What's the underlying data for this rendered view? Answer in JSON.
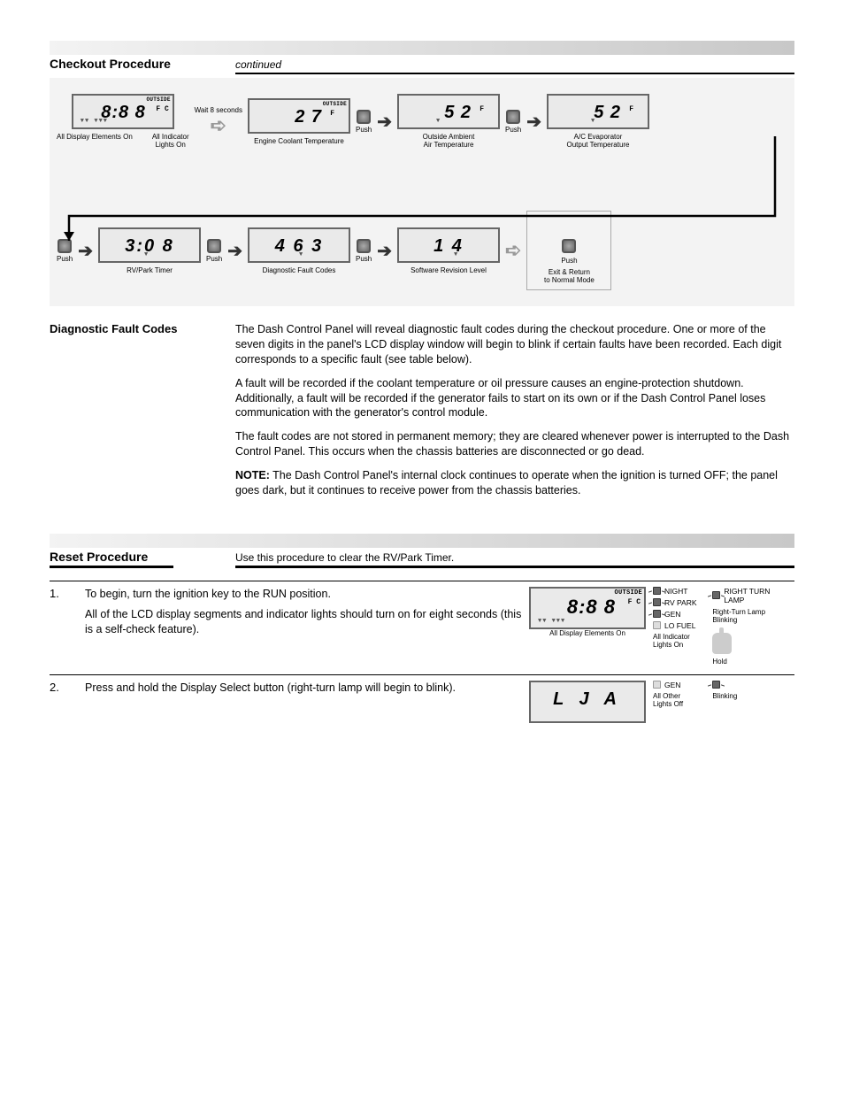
{
  "section1": {
    "title": "Checkout Procedure",
    "subtitle_suffix": "continued"
  },
  "flow": {
    "step1": {
      "outside": "OUTSIDE",
      "digits": "8:8 8",
      "fc": "F C",
      "arrows": "▼▼   ▼▼▼",
      "cap_left": "All Display Elements On",
      "cap_right": "All Indicator\nLights On"
    },
    "wait": "Wait 8 seconds",
    "step2": {
      "outside": "OUTSIDE",
      "digits": "2 7",
      "f": "F",
      "cap_left": "Engine Coolant Temperature",
      "cap_right": ""
    },
    "push": "Push",
    "step3": {
      "digits": "5 2",
      "f": "F",
      "arrow_pos": "▼",
      "cap_left": "Outside Ambient\nAir Temperature",
      "cap_right": ""
    },
    "step4": {
      "digits": "5 2",
      "f": "F",
      "arrow_pos": "▼",
      "cap_left": "A/C Evaporator\nOutput Temperature",
      "cap_right": ""
    },
    "step5": {
      "digits": "3:0 8",
      "arrow_pos": "▼",
      "cap": "RV/Park Timer"
    },
    "step6": {
      "digits": "4 6 3",
      "arrow_pos": "▼",
      "cap": "Diagnostic Fault Codes"
    },
    "step7": {
      "digits": "1 4",
      "arrow_pos": "▼",
      "cap": "Software Revision Level"
    },
    "final": {
      "label": "Push",
      "text": "Exit & Return\nto Normal Mode"
    }
  },
  "diag_block": {
    "heading": "Diagnostic Fault Codes",
    "paras": [
      "The Dash Control Panel will reveal diagnostic fault codes during the checkout procedure. One or more of the seven digits in the panel's LCD display window will begin to blink if certain faults have been recorded. Each digit corresponds to a specific fault (see table below).",
      "A fault will be recorded if the coolant temperature or oil pressure causes an engine-protection shutdown. Additionally, a fault will be recorded if the generator fails to start on its own or if the Dash Control Panel loses communication with the generator's control module.",
      "The fault codes are not stored in permanent memory; they are cleared whenever power is interrupted to the Dash Control Panel. This occurs when the chassis batteries are disconnected or go dead."
    ],
    "note_label": "NOTE:",
    "note_text": "The Dash Control Panel's internal clock continues to operate when the ignition is turned OFF; the panel goes dark, but it continues to receive power from the chassis batteries."
  },
  "section2": {
    "title": "Reset Procedure",
    "subtitle": "Use this procedure to clear the RV/Park Timer."
  },
  "reset_steps": {
    "s1": {
      "num": "1.",
      "text": "To begin, turn the ignition key to the RUN position.",
      "text2": "All of the LCD display segments and indicator lights should turn on for eight seconds (this is a self-check feature).",
      "lcd": {
        "outside": "OUTSIDE",
        "digits": "8:8 8",
        "fc": "F C",
        "arrows": "▼▼   ▼▼▼"
      },
      "cap_lcd": "All Display Elements On",
      "leds": [
        "NIGHT",
        "RV PARK",
        "GEN",
        "LO FUEL"
      ],
      "led_cap": "All Indicator\nLights On",
      "rtl_label": "RIGHT TURN\nLAMP",
      "rtl_cap": "Right-Turn Lamp\nBlinking",
      "hand": "Hold"
    },
    "s2": {
      "num": "2.",
      "text": "Press and hold the Display Select button (right-turn lamp will begin to blink).",
      "lcd_digits": "L J A",
      "led_row_label": "GEN",
      "other": "All Other\nLights Off",
      "blink": "Blinking"
    }
  }
}
